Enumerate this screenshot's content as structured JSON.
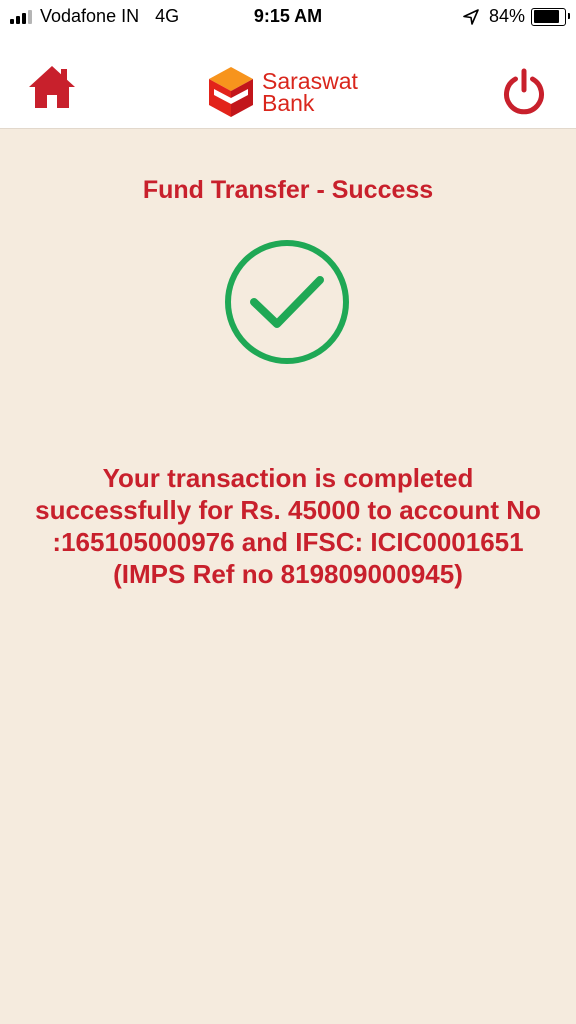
{
  "status_bar": {
    "carrier": "Vodafone IN",
    "network": "4G",
    "time": "9:15 AM",
    "battery": "84%",
    "battery_level": 0.84
  },
  "header": {
    "logo_line1": "Saraswat",
    "logo_line2": "Bank",
    "home_icon": "home-icon",
    "power_icon": "power-icon"
  },
  "main": {
    "title": "Fund Transfer - Success",
    "status_icon": "success-check-icon",
    "message": "Your transaction is completed successfully for Rs. 45000 to account No :165105000976 and IFSC: ICIC0001651 (IMPS Ref no 819809000945)"
  },
  "colors": {
    "brand_red": "#c8202c",
    "success_green": "#1fa855",
    "background": "#f5ebde"
  }
}
